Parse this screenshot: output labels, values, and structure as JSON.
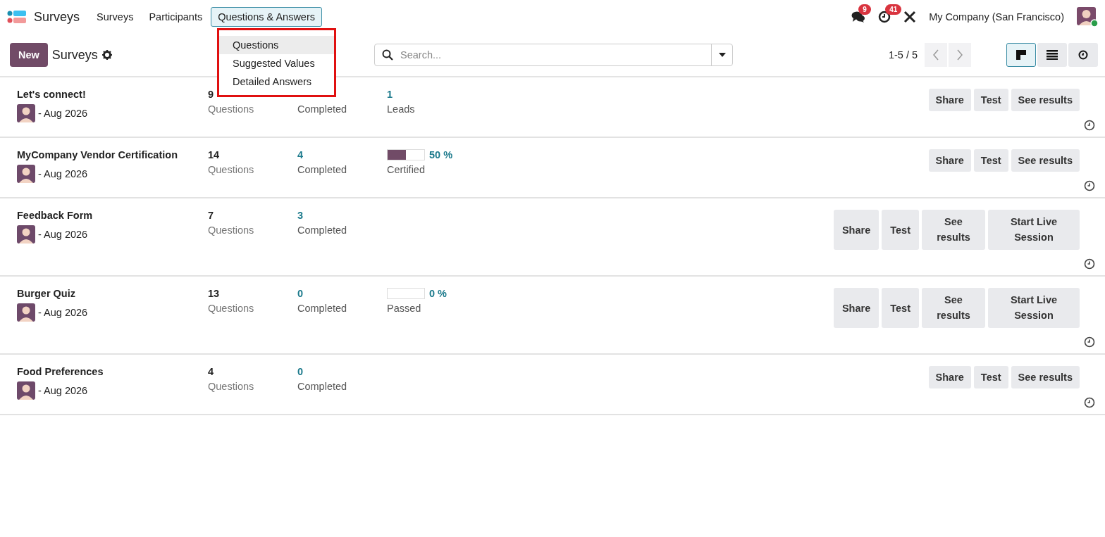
{
  "app": {
    "name": "Surveys",
    "menu": [
      {
        "label": "Surveys",
        "selected": false
      },
      {
        "label": "Participants",
        "selected": false
      },
      {
        "label": "Questions & Answers",
        "selected": true
      }
    ]
  },
  "dropdown": {
    "items": [
      {
        "label": "Questions",
        "selected": true
      },
      {
        "label": "Suggested Values",
        "selected": false
      },
      {
        "label": "Detailed Answers",
        "selected": false
      }
    ]
  },
  "systray": {
    "messages_badge": "9",
    "activities_badge": "41",
    "company": "My Company (San Francisco)"
  },
  "control_panel": {
    "new_button": "New",
    "title": "Surveys",
    "search": {
      "placeholder": "Search..."
    },
    "pager": "1-5 / 5",
    "views": [
      {
        "kind": "kanban",
        "selected": true
      },
      {
        "kind": "list",
        "selected": false
      },
      {
        "kind": "activity",
        "selected": false
      }
    ]
  },
  "surveys": [
    {
      "title": "Let's connect!",
      "date": "- Aug 2026",
      "questions": "9",
      "questions_label": "Questions",
      "completed_label": "Completed",
      "stat": {
        "kind": "count",
        "value": "1",
        "label": "Leads"
      },
      "buttons": [
        "Share",
        "Test",
        "See results"
      ]
    },
    {
      "title": "MyCompany Vendor Certification",
      "date": "- Aug 2026",
      "questions": "14",
      "questions_label": "Questions",
      "completed": "4",
      "completed_label": "Completed",
      "stat": {
        "kind": "progress",
        "level": 0.5,
        "value": "50 %",
        "label": "Certified"
      },
      "buttons": [
        "Share",
        "Test",
        "See results"
      ]
    },
    {
      "title": "Feedback Form",
      "date": "- Aug 2026",
      "questions": "7",
      "questions_label": "Questions",
      "completed": "3",
      "completed_label": "Completed",
      "buttons": [
        "Share",
        "Test",
        "See results",
        "Start Live Session"
      ]
    },
    {
      "title": "Burger Quiz",
      "date": "- Aug 2026",
      "questions": "13",
      "questions_label": "Questions",
      "completed": "0",
      "completed_label": "Completed",
      "stat": {
        "kind": "progress",
        "level": 0,
        "value": "0 %",
        "label": "Passed"
      },
      "buttons": [
        "Share",
        "Test",
        "See results",
        "Start Live Session"
      ]
    },
    {
      "title": "Food Preferences",
      "date": "- Aug 2026",
      "questions": "4",
      "questions_label": "Questions",
      "completed": "0",
      "completed_label": "Completed",
      "buttons": [
        "Share",
        "Test",
        "See results"
      ]
    }
  ]
}
